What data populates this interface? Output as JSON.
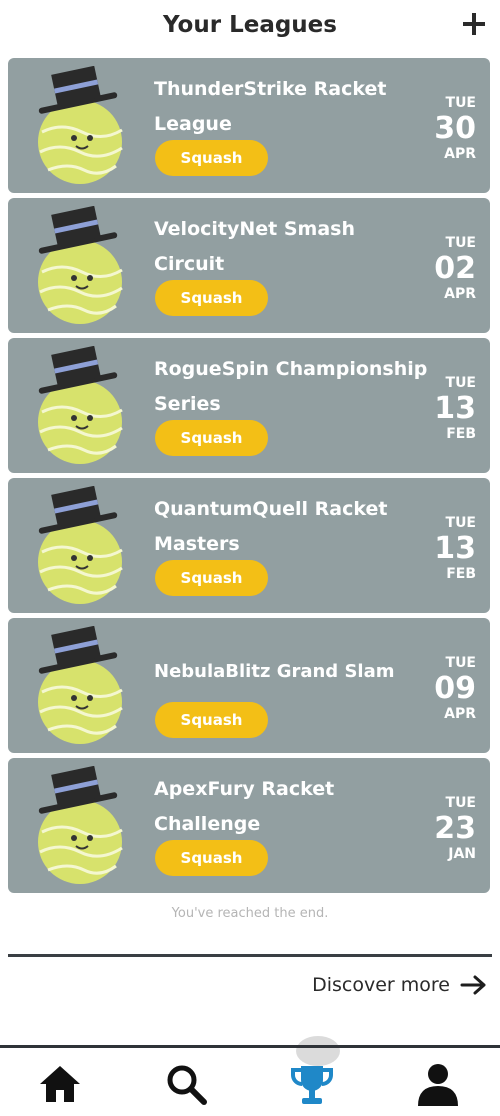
{
  "header": {
    "title": "Your Leagues"
  },
  "leagues": [
    {
      "name": "ThunderStrike Racket League",
      "sport": "Squash",
      "dow": "TUE",
      "day": "30",
      "month": "APR"
    },
    {
      "name": "VelocityNet Smash Circuit",
      "sport": "Squash",
      "dow": "TUE",
      "day": "02",
      "month": "APR"
    },
    {
      "name": "RogueSpin Championship Series",
      "sport": "Squash",
      "dow": "TUE",
      "day": "13",
      "month": "FEB"
    },
    {
      "name": "QuantumQuell Racket Masters",
      "sport": "Squash",
      "dow": "TUE",
      "day": "13",
      "month": "FEB"
    },
    {
      "name": "NebulaBlitz Grand Slam",
      "sport": "Squash",
      "dow": "TUE",
      "day": "09",
      "month": "APR"
    },
    {
      "name": "ApexFury Racket Challenge",
      "sport": "Squash",
      "dow": "TUE",
      "day": "23",
      "month": "JAN"
    }
  ],
  "end_message": "You've reached the end.",
  "discover_more": "Discover more",
  "nav": {
    "items": [
      "home-icon",
      "search-icon",
      "trophy-icon",
      "profile-icon"
    ],
    "active": "trophy-icon"
  },
  "colors": {
    "card": "#929fa1",
    "tag": "#f3bf16",
    "active_nav": "#1f88c8",
    "mascot_ball": "#d7e26c"
  }
}
